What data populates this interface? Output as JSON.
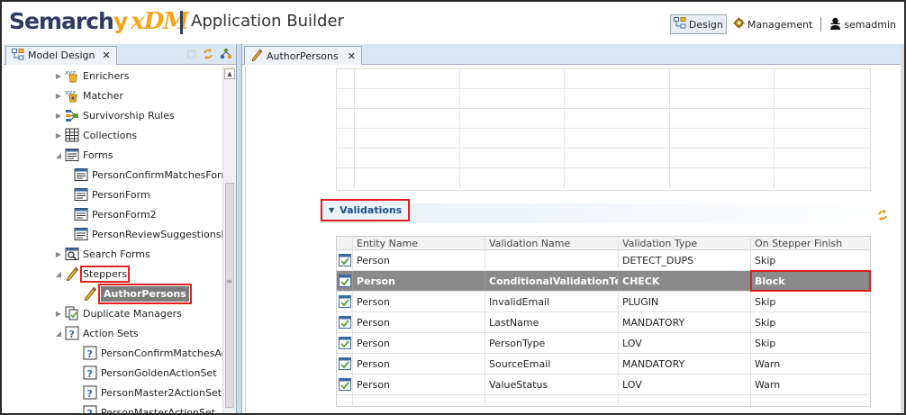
{
  "header": {
    "logo_main": "Semarch",
    "logo_y": "y",
    "logo_suffix": "xDM",
    "app_title": "Application Builder",
    "design_label": "Design",
    "management_label": "Management",
    "user_label": "semadmin"
  },
  "left_panel": {
    "tab_label": "Model Design",
    "tree": [
      {
        "label": "Enrichers",
        "icon": "enricher-icon",
        "arrow": "collapsed",
        "indent": 0
      },
      {
        "label": "Matcher",
        "icon": "matcher-icon",
        "arrow": "collapsed",
        "indent": 0
      },
      {
        "label": "Survivorship Rules",
        "icon": "survivorship-icon",
        "arrow": "collapsed",
        "indent": 0
      },
      {
        "label": "Collections",
        "icon": "table-icon",
        "arrow": "collapsed",
        "indent": 0
      },
      {
        "label": "Forms",
        "icon": "form-icon",
        "arrow": "expanded",
        "indent": 0
      },
      {
        "label": "PersonConfirmMatchesForm",
        "icon": "form-icon",
        "arrow": "none",
        "indent": 1
      },
      {
        "label": "PersonForm",
        "icon": "form-icon",
        "arrow": "none",
        "indent": 1
      },
      {
        "label": "PersonForm2",
        "icon": "form-icon",
        "arrow": "none",
        "indent": 1
      },
      {
        "label": "PersonReviewSuggestionsFo",
        "icon": "form-icon",
        "arrow": "none",
        "indent": 1
      },
      {
        "label": "Search Forms",
        "icon": "search-form-icon",
        "arrow": "collapsed",
        "indent": 0
      },
      {
        "label": "Steppers",
        "icon": "pencil-icon",
        "arrow": "expanded",
        "indent": 0
      },
      {
        "label": "AuthorPersons",
        "icon": "pencil-icon",
        "arrow": "none",
        "indent": 1
      },
      {
        "label": "Duplicate Managers",
        "icon": "duplicate-manager-icon",
        "arrow": "collapsed",
        "indent": 0
      },
      {
        "label": "Action Sets",
        "icon": "action-set-icon",
        "arrow": "expanded",
        "indent": 0
      },
      {
        "label": "PersonConfirmMatchesAction",
        "icon": "action-set-icon",
        "arrow": "none",
        "indent": 1
      },
      {
        "label": "PersonGoldenActionSet",
        "icon": "action-set-icon",
        "arrow": "none",
        "indent": 1
      },
      {
        "label": "PersonMaster2ActionSet",
        "icon": "action-set-icon",
        "arrow": "none",
        "indent": 1
      },
      {
        "label": "PersonMasterActionSet",
        "icon": "action-set-icon",
        "arrow": "none",
        "indent": 1
      }
    ]
  },
  "editor": {
    "tab_label": "AuthorPersons",
    "section_title": "Validations",
    "columns": [
      "Entity Name",
      "Validation Name",
      "Validation Type",
      "On Stepper Finish"
    ],
    "rows": [
      {
        "entity": "Person",
        "name": "",
        "type": "DETECT_DUPS",
        "finish": "Skip"
      },
      {
        "entity": "Person",
        "name": "ConditionalValidationTest",
        "type": "CHECK",
        "finish": "Block"
      },
      {
        "entity": "Person",
        "name": "InvalidEmail",
        "type": "PLUGIN",
        "finish": "Skip"
      },
      {
        "entity": "Person",
        "name": "LastName",
        "type": "MANDATORY",
        "finish": "Skip"
      },
      {
        "entity": "Person",
        "name": "PersonType",
        "type": "LOV",
        "finish": "Skip"
      },
      {
        "entity": "Person",
        "name": "SourceEmail",
        "type": "MANDATORY",
        "finish": "Warn"
      },
      {
        "entity": "Person",
        "name": "ValueStatus",
        "type": "LOV",
        "finish": "Warn"
      }
    ]
  }
}
